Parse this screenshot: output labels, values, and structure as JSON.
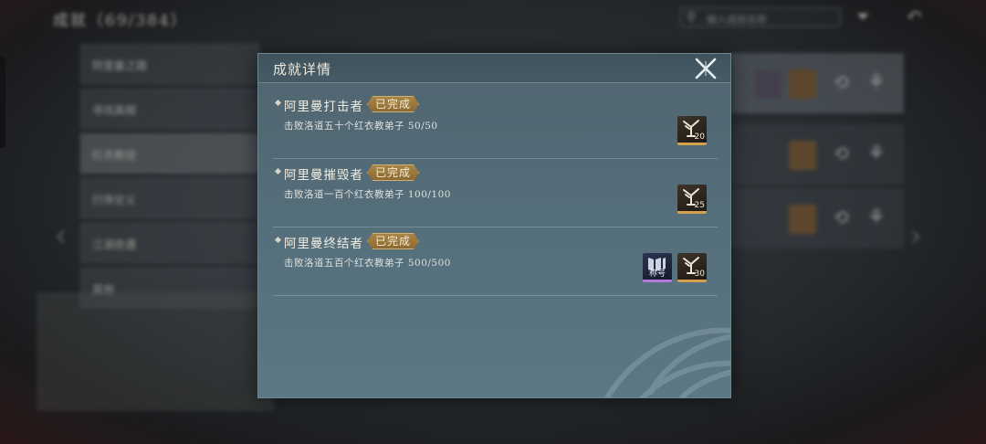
{
  "background": {
    "title": "成就（69/384）",
    "search_placeholder": "输入成就名称",
    "sidebar": [
      "阿里曼之路",
      "寻找真相",
      "红衣教徒",
      "行侠仗义",
      "江湖奇遇",
      "其他"
    ]
  },
  "modal": {
    "title": "成就详情",
    "achievements": [
      {
        "name": "阿里曼打击者",
        "status": "已完成",
        "description": "击败洛道五十个红衣教弟子 50/50",
        "rewards": [
          {
            "type": "coin",
            "icon": "coin-reward-icon",
            "count": "20"
          }
        ]
      },
      {
        "name": "阿里曼摧毁者",
        "status": "已完成",
        "description": "击败洛道一百个红衣教弟子 100/100",
        "rewards": [
          {
            "type": "coin",
            "icon": "coin-reward-icon",
            "count": "25"
          }
        ]
      },
      {
        "name": "阿里曼终结者",
        "status": "已完成",
        "description": "击败洛道五百个红衣教弟子 500/500",
        "rewards": [
          {
            "type": "title",
            "icon": "title-reward-icon",
            "label": "称号"
          },
          {
            "type": "coin",
            "icon": "coin-reward-icon",
            "count": "30"
          }
        ]
      }
    ]
  },
  "colors": {
    "badge": "#a88545",
    "coin_rarity": "#d4a04e",
    "title_rarity": "#b47ad9",
    "panel": "#55707c"
  }
}
